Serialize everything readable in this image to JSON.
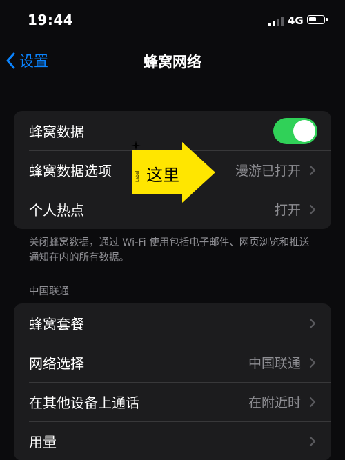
{
  "status_bar": {
    "time": "19:44",
    "network": "4G",
    "signal_bars_active": 2,
    "battery_level": 0.55
  },
  "nav": {
    "back_label": "设置",
    "title": "蜂窝网络"
  },
  "group1": {
    "rows": [
      {
        "label": "蜂窝数据",
        "toggle_on": true
      },
      {
        "label": "蜂窝数据选项",
        "value": "漫游已打开"
      },
      {
        "label": "个人热点",
        "value": "打开"
      }
    ]
  },
  "footnote": "关闭蜂窝数据，通过 Wi-Fi 使用包括电子邮件、网页浏览和推送通知在内的所有数据。",
  "section_header": "中国联通",
  "group2": {
    "rows": [
      {
        "label": "蜂窝套餐",
        "value": ""
      },
      {
        "label": "网络选择",
        "value": "中国联通"
      },
      {
        "label": "在其他设备上通话",
        "value": "在附近时"
      },
      {
        "label": "用量",
        "value": ""
      }
    ]
  },
  "annotation": {
    "text": "这里",
    "tiny_text": "Label"
  },
  "colors": {
    "accent": "#0a84ff",
    "toggle_on": "#30d158",
    "annotation": "#ffe600",
    "group_bg": "#1c1c1e",
    "secondary_text": "#8e8e93"
  },
  "icons": {
    "back": "chevron-left-icon",
    "disclosure": "chevron-right-icon",
    "signal": "cellular-signal-icon",
    "battery": "battery-icon"
  }
}
